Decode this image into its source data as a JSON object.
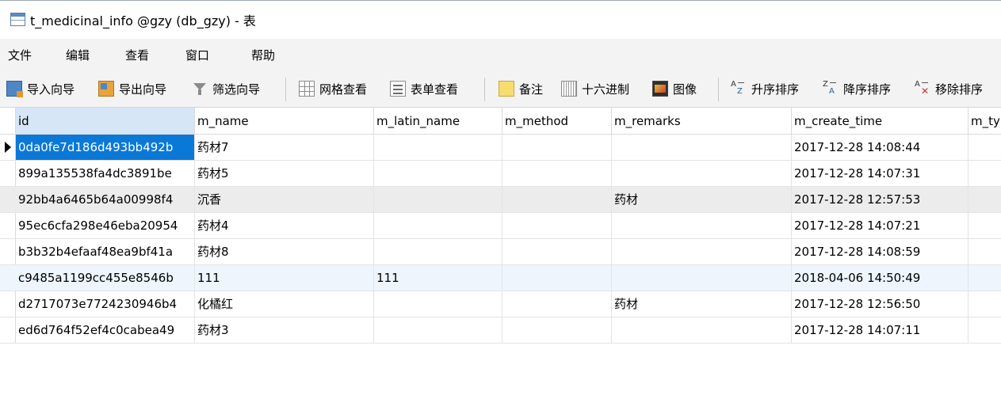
{
  "window": {
    "title": "t_medicinal_info @gzy (db_gzy) - 表"
  },
  "menu": [
    "文件",
    "编辑",
    "查看",
    "窗口",
    "帮助"
  ],
  "toolbar": {
    "import_wizard": "导入向导",
    "export_wizard": "导出向导",
    "filter_wizard": "筛选向导",
    "grid_view": "网格查看",
    "form_view": "表单查看",
    "memo": "备注",
    "hex": "十六进制",
    "image": "图像",
    "sort_asc": "升序排序",
    "sort_desc": "降序排序",
    "remove_sort": "移除排序"
  },
  "table": {
    "columns": [
      "id",
      "m_name",
      "m_latin_name",
      "m_method",
      "m_remarks",
      "m_create_time",
      "m_ty"
    ],
    "rows": [
      [
        "0da0fe7d186d493bb492b",
        "药材7",
        "",
        "",
        "",
        "2017-12-28 14:08:44",
        ""
      ],
      [
        "899a135538fa4dc3891be",
        "药材5",
        "",
        "",
        "",
        "2017-12-28 14:07:31",
        ""
      ],
      [
        "92bb4a6465b64a00998f4",
        "沉香",
        "",
        "",
        "药材",
        "2017-12-28 12:57:53",
        ""
      ],
      [
        "95ec6cfa298e46eba20954",
        "药材4",
        "",
        "",
        "",
        "2017-12-28 14:07:21",
        ""
      ],
      [
        "b3b32b4efaaf48ea9bf41a",
        "药材8",
        "",
        "",
        "",
        "2017-12-28 14:08:59",
        ""
      ],
      [
        "c9485a1199cc455e8546b",
        "111",
        "111",
        "",
        "",
        "2018-04-06 14:50:49",
        ""
      ],
      [
        "d2717073e7724230946b4",
        "化橘红",
        "",
        "",
        "药材",
        "2017-12-28 12:56:50",
        ""
      ],
      [
        "ed6d764f52ef4c0cabea49",
        "药材3",
        "",
        "",
        "",
        "2017-12-28 14:07:11",
        ""
      ]
    ]
  },
  "colors": {
    "selection": "#0a78d7",
    "header_selected": "#d6e6f7",
    "toolbar_bg": "#f3f3f3"
  }
}
